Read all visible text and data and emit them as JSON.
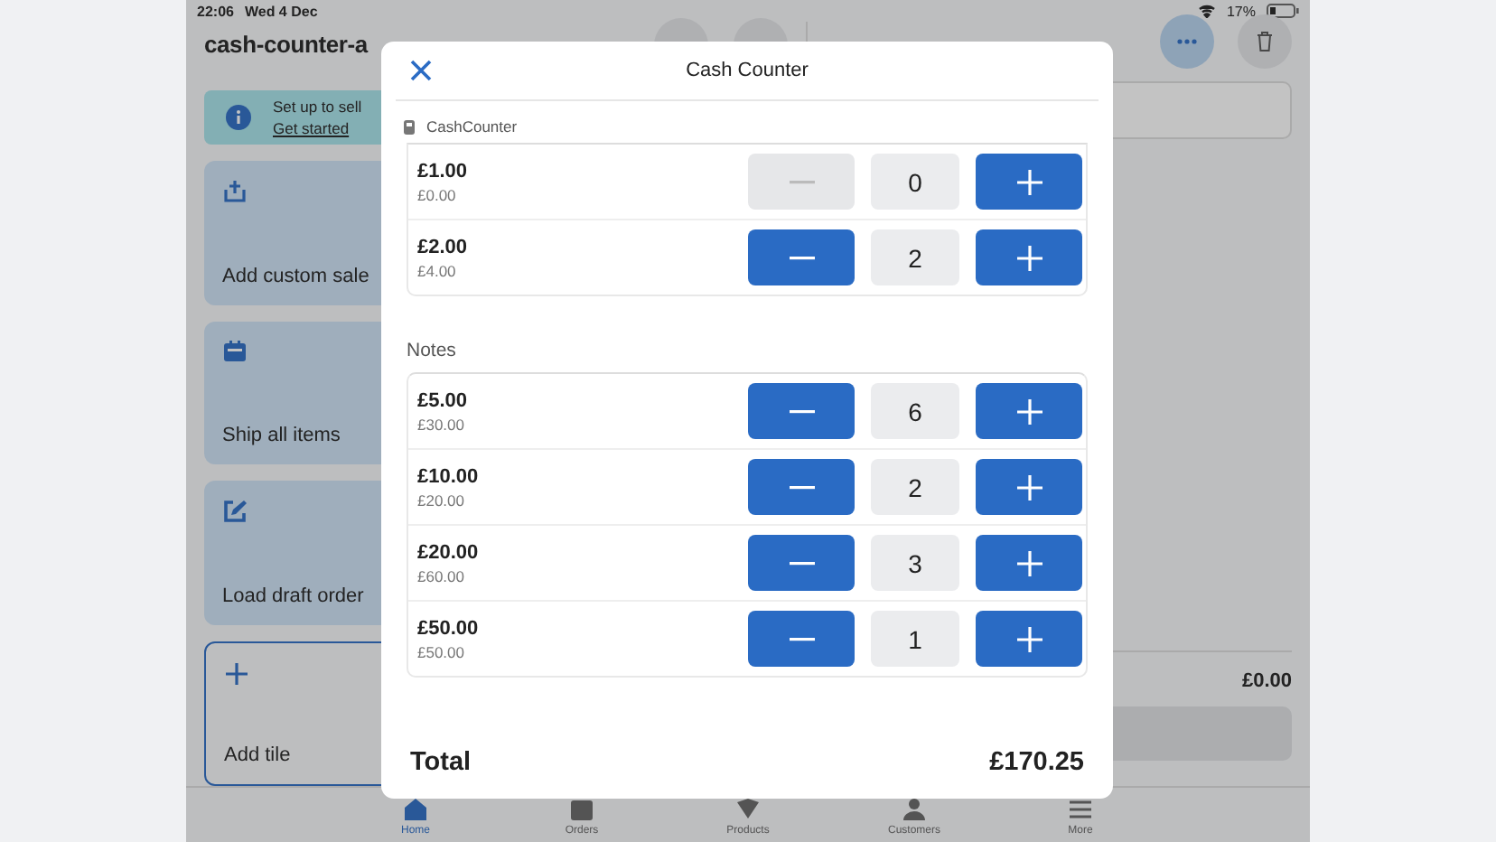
{
  "status_bar": {
    "time": "22:06",
    "date": "Wed 4 Dec",
    "battery": "17%"
  },
  "app": {
    "title": "cash-counter-a",
    "setup_banner": {
      "title": "Set up to sell",
      "link": "Get started"
    },
    "tiles": [
      {
        "label": "Add custom sale",
        "kind": "upload"
      },
      {
        "label": "Ship all items",
        "kind": "ship"
      },
      {
        "label": "Load draft order",
        "kind": "edit"
      },
      {
        "label": "Add tile",
        "kind": "add"
      }
    ],
    "cart": {
      "total": "£0.00"
    },
    "tabs": [
      {
        "label": "Home",
        "kind": "home",
        "selected": true
      },
      {
        "label": "Orders",
        "kind": "orders",
        "selected": false
      },
      {
        "label": "Products",
        "kind": "products",
        "selected": false
      },
      {
        "label": "Customers",
        "kind": "customers",
        "selected": false
      },
      {
        "label": "More",
        "kind": "more",
        "selected": false
      }
    ]
  },
  "modal": {
    "title": "Cash Counter",
    "source": "CashCounter",
    "sections": [
      {
        "rows": [
          {
            "denomination": "£1.00",
            "subtotal": "£0.00",
            "count": "0",
            "can_decrease": false
          },
          {
            "denomination": "£2.00",
            "subtotal": "£4.00",
            "count": "2",
            "can_decrease": true
          }
        ]
      },
      {
        "heading": "Notes",
        "rows": [
          {
            "denomination": "£5.00",
            "subtotal": "£30.00",
            "count": "6",
            "can_decrease": true
          },
          {
            "denomination": "£10.00",
            "subtotal": "£20.00",
            "count": "2",
            "can_decrease": true
          },
          {
            "denomination": "£20.00",
            "subtotal": "£60.00",
            "count": "3",
            "can_decrease": true
          },
          {
            "denomination": "£50.00",
            "subtotal": "£50.00",
            "count": "1",
            "can_decrease": true
          }
        ]
      }
    ],
    "total_label": "Total",
    "total": "£170.25"
  }
}
